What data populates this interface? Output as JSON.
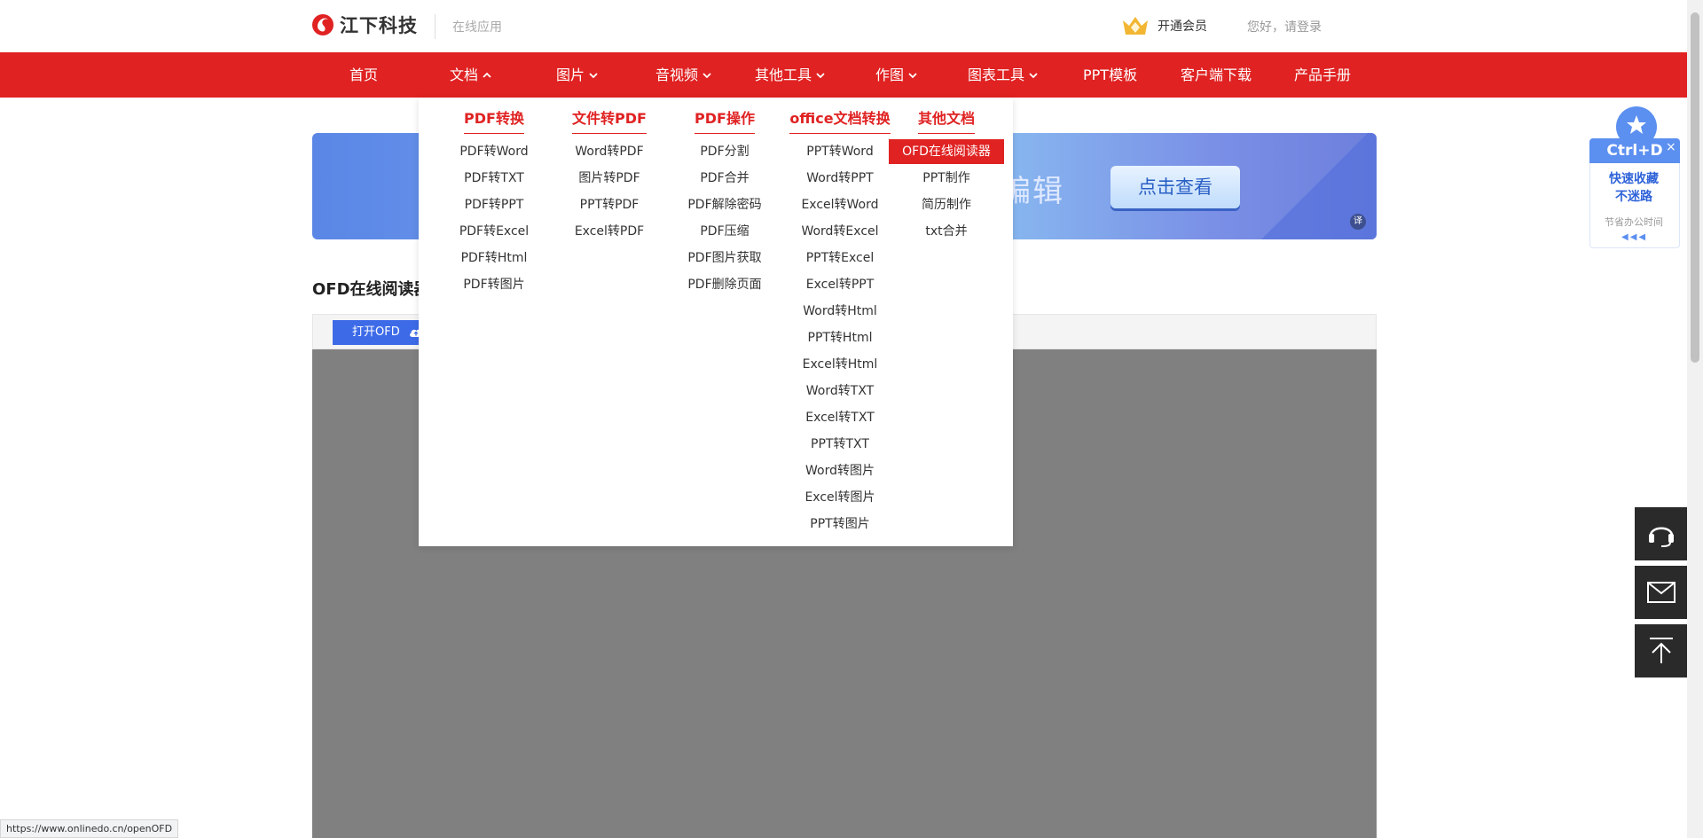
{
  "header": {
    "brand": "江下科技",
    "subtitle": "在线应用",
    "vip_label": "开通会员",
    "login_label": "您好，请登录"
  },
  "nav": {
    "items": [
      {
        "label": "首页",
        "dropdown": false
      },
      {
        "label": "文档",
        "dropdown": true,
        "expanded": true
      },
      {
        "label": "图片",
        "dropdown": true
      },
      {
        "label": "音视频",
        "dropdown": true
      },
      {
        "label": "其他工具",
        "dropdown": true
      },
      {
        "label": "作图",
        "dropdown": true
      },
      {
        "label": "图表工具",
        "dropdown": true
      },
      {
        "label": "PPT模板",
        "dropdown": false
      },
      {
        "label": "客户端下载",
        "dropdown": false
      },
      {
        "label": "产品手册",
        "dropdown": false
      }
    ]
  },
  "dropdown": {
    "columns": [
      {
        "title": "PDF转换",
        "items": [
          "PDF转Word",
          "PDF转TXT",
          "PDF转PPT",
          "PDF转Excel",
          "PDF转Html",
          "PDF转图片"
        ]
      },
      {
        "title": "文件转PDF",
        "items": [
          "Word转PDF",
          "图片转PDF",
          "PPT转PDF",
          "Excel转PDF"
        ]
      },
      {
        "title": "PDF操作",
        "items": [
          "PDF分割",
          "PDF合并",
          "PDF解除密码",
          "PDF压缩",
          "PDF图片获取",
          "PDF删除页面"
        ]
      },
      {
        "title": "office文档转换",
        "items": [
          "PPT转Word",
          "Word转PPT",
          "Excel转Word",
          "Word转Excel",
          "PPT转Excel",
          "Excel转PPT",
          "Word转Html",
          "PPT转Html",
          "Excel转Html",
          "Word转TXT",
          "Excel转TXT",
          "PPT转TXT",
          "Word转图片",
          "Excel转图片",
          "PPT转图片"
        ]
      },
      {
        "title": "其他文档",
        "items": [
          "OFD在线阅读器",
          "PPT制作",
          "简历制作",
          "txt合并"
        ],
        "active_index": 0
      }
    ]
  },
  "banner": {
    "text": "编辑",
    "button": "点击查看",
    "badge": "译"
  },
  "page": {
    "title": "OFD在线阅读器"
  },
  "viewer": {
    "open_button": "打开OFD"
  },
  "favorite": {
    "shortcut": "Ctrl+D",
    "close": "×",
    "line1": "快速收藏",
    "line2": "不迷路",
    "line3": "节省办公时间",
    "arrows": "◀◀◀"
  },
  "status_url": "https://www.onlinedo.cn/openOFD",
  "colors": {
    "brand_red": "#e02222",
    "accent_blue": "#3d6be8",
    "viewer_gray": "#808080"
  }
}
